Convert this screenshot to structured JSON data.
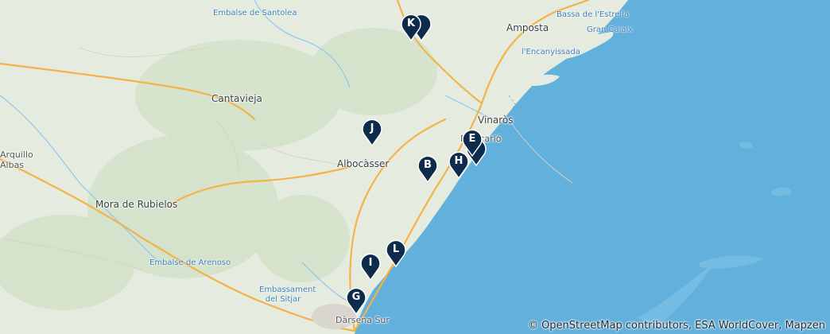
{
  "map": {
    "colors": {
      "land": "#e5ecdf",
      "sea": "#62b0dc",
      "road": "#f3b348",
      "river": "#8ec7ee",
      "marker": "#0d2b4a"
    },
    "places": [
      {
        "name": "Embalse de Santolea",
        "kind": "water"
      },
      {
        "name": "Amposta",
        "kind": "town"
      },
      {
        "name": "Bassa de l'Estrella",
        "kind": "water"
      },
      {
        "name": "Gran Calaix",
        "kind": "water"
      },
      {
        "name": "l'Encanyissada",
        "kind": "water"
      },
      {
        "name": "Cantavieja",
        "kind": "town"
      },
      {
        "name": "Vinaròs",
        "kind": "town"
      },
      {
        "name": "Benicarló",
        "kind": "town"
      },
      {
        "name": "Arquillo",
        "kind": "town"
      },
      {
        "name": "Albas",
        "kind": "town"
      },
      {
        "name": "Albocàsser",
        "kind": "town"
      },
      {
        "name": "Mora de Rubielos",
        "kind": "town"
      },
      {
        "name": "Embalse de Arenoso",
        "kind": "water"
      },
      {
        "name": "Embassament del Sitjar",
        "kind": "water"
      },
      {
        "name": "Dàrsena Sur",
        "kind": "town"
      }
    ],
    "markers": [
      {
        "label": "K"
      },
      {
        "label": ""
      },
      {
        "label": "J"
      },
      {
        "label": "E"
      },
      {
        "label": ""
      },
      {
        "label": "H"
      },
      {
        "label": "B"
      },
      {
        "label": "L"
      },
      {
        "label": "I"
      },
      {
        "label": "G"
      }
    ],
    "attribution": "© OpenStreetMap contributors, ESA WorldCover, Mapzen"
  }
}
